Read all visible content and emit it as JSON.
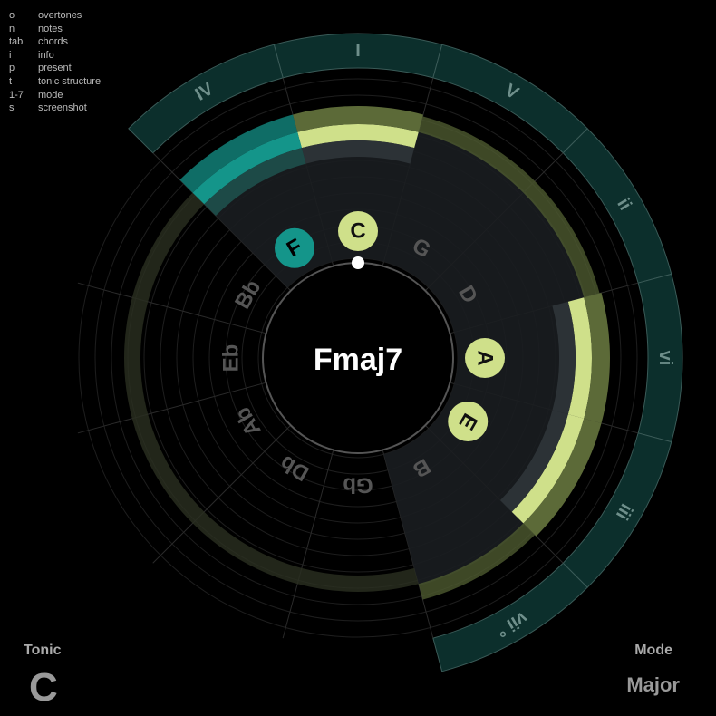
{
  "shortcuts": [
    {
      "key": "o",
      "action": "overtones"
    },
    {
      "key": "n",
      "action": "notes"
    },
    {
      "key": "tab",
      "action": "chords"
    },
    {
      "key": "i",
      "action": "info"
    },
    {
      "key": "p",
      "action": "present"
    },
    {
      "key": "t",
      "action": "tonic structure"
    },
    {
      "key": "1-7",
      "action": "mode"
    },
    {
      "key": "s",
      "action": "screenshot"
    }
  ],
  "chord_name": "Fmaj7",
  "notes_circle": [
    "C",
    "G",
    "D",
    "A",
    "E",
    "B",
    "Gb",
    "Db",
    "Ab",
    "Eb",
    "Bb",
    "F"
  ],
  "active_notes": [
    "F",
    "C",
    "A",
    "E"
  ],
  "root_note": "F",
  "tonic_marker": "C",
  "scale_degrees": [
    {
      "note": "C",
      "numeral": "I"
    },
    {
      "note": "G",
      "numeral": "V"
    },
    {
      "note": "D",
      "numeral": "ii"
    },
    {
      "note": "A",
      "numeral": "vi"
    },
    {
      "note": "E",
      "numeral": "iii"
    },
    {
      "note": "B",
      "numeral": "vii °"
    },
    {
      "note": "F",
      "numeral": "IV"
    }
  ],
  "tonic": {
    "label": "Tonic",
    "value": "C"
  },
  "mode": {
    "label": "Mode",
    "value": "Major"
  },
  "colors": {
    "background": "#000000",
    "active_note": "#cfe08a",
    "root_note": "#14958a",
    "numeral_band": "#0c2f2c",
    "inactive_note_text": "#555555",
    "overtone_olive": "#4d5a30"
  }
}
